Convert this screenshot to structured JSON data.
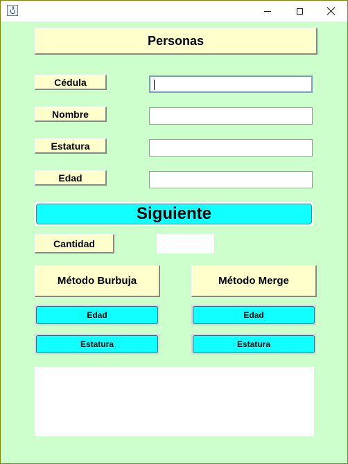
{
  "window": {
    "controls": {
      "minimize": "minimize",
      "maximize": "maximize",
      "close": "close"
    }
  },
  "form": {
    "title": "Personas",
    "fields": [
      {
        "label": "Cédula",
        "value": ""
      },
      {
        "label": "Nombre",
        "value": ""
      },
      {
        "label": "Estatura",
        "value": ""
      },
      {
        "label": "Edad",
        "value": ""
      }
    ],
    "next_button": "Siguiente",
    "count": {
      "label": "Cantidad",
      "value": ""
    }
  },
  "methods": {
    "bubble": {
      "label": "Método Burbuja",
      "age_button": "Edad",
      "height_button": "Estatura"
    },
    "merge": {
      "label": "Método Merge",
      "age_button": "Edad",
      "height_button": "Estatura"
    }
  },
  "output": {
    "text": ""
  },
  "colors": {
    "background": "#ccffcc",
    "label_bg": "#ffffcc",
    "button_bg": "#11ffff"
  }
}
